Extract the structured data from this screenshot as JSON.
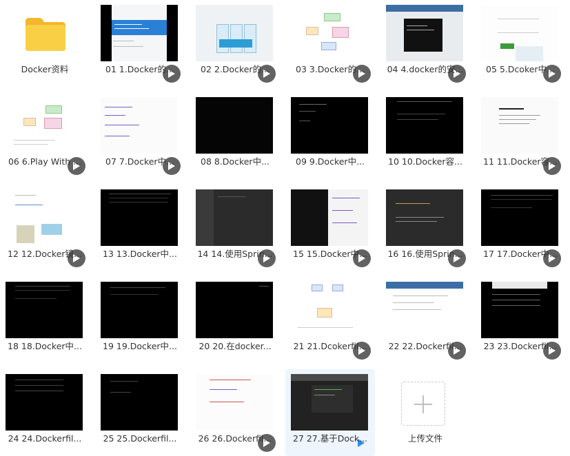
{
  "folder": {
    "name": "Docker资料",
    "icon": "folder-icon"
  },
  "videos": [
    {
      "id": "v01",
      "title": "01 1.Docker的..."
    },
    {
      "id": "v02",
      "title": "02 2.Docker的..."
    },
    {
      "id": "v03",
      "title": "03 3.Docker的..."
    },
    {
      "id": "v04",
      "title": "04 4.docker的安..."
    },
    {
      "id": "v05",
      "title": "05 5.Dcoker中..."
    },
    {
      "id": "v06",
      "title": "06 6.Play With ..."
    },
    {
      "id": "v07",
      "title": "07 7.Docker中..."
    },
    {
      "id": "v08",
      "title": "08 8.Docker中..."
    },
    {
      "id": "v09",
      "title": "09 9.Docker中..."
    },
    {
      "id": "v10",
      "title": "10 10.Docker容..."
    },
    {
      "id": "v11",
      "title": "11 11.Docker容..."
    },
    {
      "id": "v12",
      "title": "12 12.Docker镜..."
    },
    {
      "id": "v13",
      "title": "13 13.Docker中..."
    },
    {
      "id": "v14",
      "title": "14 14.使用Sprin..."
    },
    {
      "id": "v15",
      "title": "15 15.Docker中..."
    },
    {
      "id": "v16",
      "title": "16 16.使用Sprin..."
    },
    {
      "id": "v17",
      "title": "17 17.Docker中..."
    },
    {
      "id": "v18",
      "title": "18 18.Docker中..."
    },
    {
      "id": "v19",
      "title": "19 19.Docker中..."
    },
    {
      "id": "v20",
      "title": "20 20.在docker..."
    },
    {
      "id": "v21",
      "title": "21 21.Dcokerfil..."
    },
    {
      "id": "v22",
      "title": "22 22.Dockerfil..."
    },
    {
      "id": "v23",
      "title": "23 23.Dockerfil..."
    },
    {
      "id": "v24",
      "title": "24 24.Dockerfil..."
    },
    {
      "id": "v25",
      "title": "25 25.Dockerfil..."
    },
    {
      "id": "v26",
      "title": "26 26.Dockerfil..."
    },
    {
      "id": "v27",
      "title": "27 27.基于Dock...",
      "selected": true
    }
  ],
  "upload": {
    "label": "上传文件",
    "icon": "plus-icon"
  },
  "colors": {
    "selection": "#eef5fd",
    "selected_play": "#2d8cf0",
    "folder": "#f7c531"
  }
}
